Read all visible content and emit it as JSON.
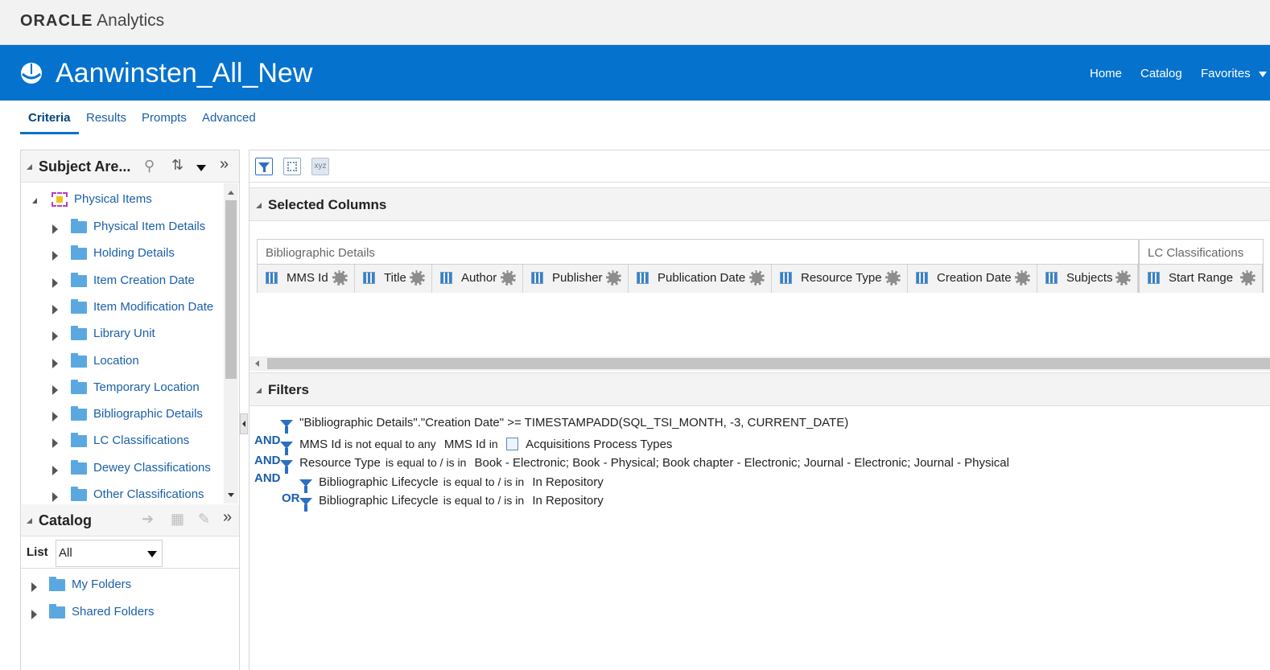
{
  "app": {
    "brand": "ORACLE",
    "product": "Analytics",
    "analysis_title": "Aanwinsten_All_New"
  },
  "topnav": {
    "home": "Home",
    "catalog": "Catalog",
    "favorites": "Favorites"
  },
  "tabs": [
    {
      "label": "Criteria",
      "active": true
    },
    {
      "label": "Results",
      "active": false
    },
    {
      "label": "Prompts",
      "active": false
    },
    {
      "label": "Advanced",
      "active": false
    }
  ],
  "subject_areas": {
    "header": "Subject Are...",
    "root": "Physical Items",
    "items": [
      "Physical Item Details",
      "Holding Details",
      "Item Creation Date",
      "Item Modification Date",
      "Library Unit",
      "Location",
      "Temporary Location",
      "Bibliographic Details",
      "LC Classifications",
      "Dewey Classifications",
      "Other Classifications"
    ]
  },
  "catalog": {
    "header": "Catalog",
    "list_label": "List",
    "list_value": "All",
    "items": [
      "My Folders",
      "Shared Folders"
    ]
  },
  "selected_columns": {
    "header": "Selected Columns",
    "groups": [
      {
        "name": "Bibliographic Details",
        "columns": [
          "MMS Id",
          "Title",
          "Author",
          "Publisher",
          "Publication Date",
          "Resource Type",
          "Creation Date",
          "Subjects"
        ]
      },
      {
        "name": "LC Classifications",
        "columns": [
          "Start Range"
        ]
      }
    ]
  },
  "filters": {
    "header": "Filters",
    "lines": [
      {
        "op": "",
        "text": "\"Bibliographic Details\".\"Creation Date\" >= TIMESTAMPADD(SQL_TSI_MONTH, -3, CURRENT_DATE)"
      },
      {
        "op": "AND",
        "col": "MMS Id",
        "cond": "is not equal to any",
        "col2": "MMS Id",
        "in": "in",
        "value": "Acquisitions Process Types"
      },
      {
        "op": "AND",
        "col": "Resource Type",
        "cond": "is equal to / is in",
        "value": "Book - Electronic; Book - Physical; Book chapter - Electronic; Journal - Electronic; Journal - Physical"
      },
      {
        "op": "AND",
        "col": "Bibliographic Lifecycle",
        "cond": "is equal to / is in",
        "value": "In Repository"
      },
      {
        "op": "OR",
        "col": "Bibliographic Lifecycle",
        "cond": "is equal to / is in",
        "value": "In Repository"
      }
    ]
  },
  "colors": {
    "banner": "#0572ce",
    "link": "#1a5fa8",
    "folder": "#5ba8e0"
  }
}
